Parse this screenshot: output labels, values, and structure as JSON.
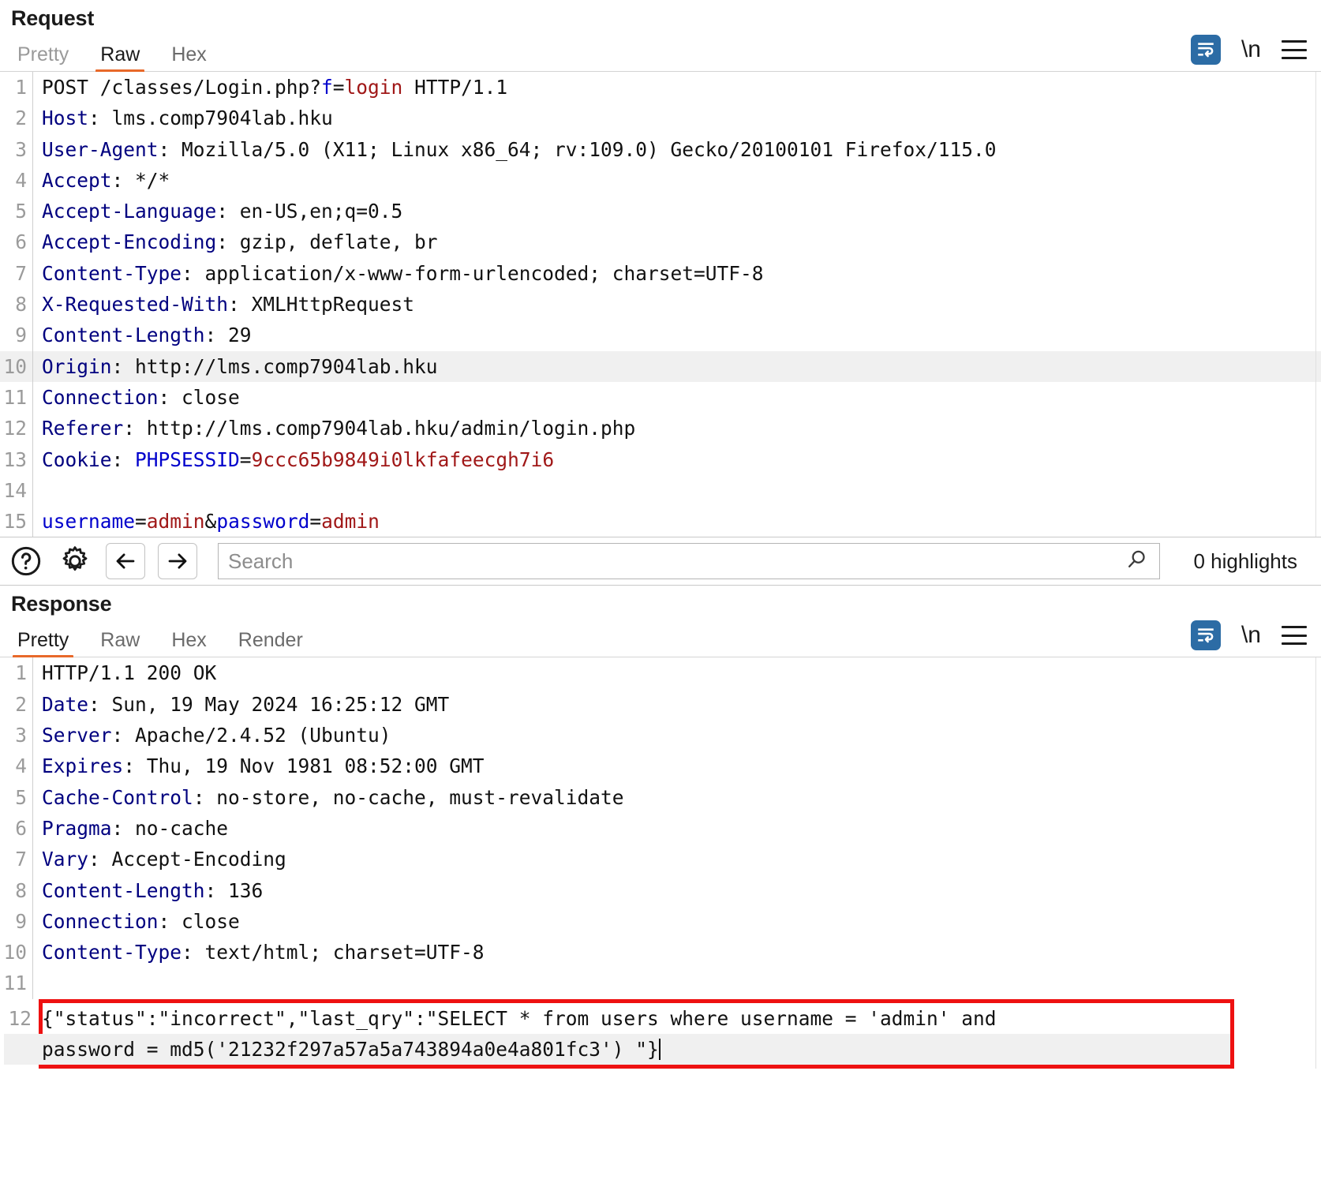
{
  "request": {
    "title": "Request",
    "tabs": [
      {
        "label": "Pretty",
        "active": false
      },
      {
        "label": "Raw",
        "active": true
      },
      {
        "label": "Hex",
        "active": false
      }
    ],
    "tools": {
      "wrap_icon": "word-wrap-icon",
      "newline_label": "\\n",
      "menu_icon": "hamburger-menu-icon"
    },
    "lines": [
      {
        "n": "1",
        "highlight": false,
        "parts": [
          {
            "t": "POST /classes/Login.php?",
            "c": "plain"
          },
          {
            "t": "f",
            "c": "blue"
          },
          {
            "t": "=",
            "c": "plain"
          },
          {
            "t": "login",
            "c": "red"
          },
          {
            "t": " HTTP/1.1",
            "c": "plain"
          }
        ]
      },
      {
        "n": "2",
        "highlight": false,
        "parts": [
          {
            "t": "Host",
            "c": "hdr"
          },
          {
            "t": ": lms.comp7904lab.hku",
            "c": "plain"
          }
        ]
      },
      {
        "n": "3",
        "highlight": false,
        "parts": [
          {
            "t": "User-Agent",
            "c": "hdr"
          },
          {
            "t": ": Mozilla/5.0 (X11; Linux x86_64; rv:109.0) Gecko/20100101 Firefox/115.0",
            "c": "plain"
          }
        ]
      },
      {
        "n": "4",
        "highlight": false,
        "parts": [
          {
            "t": "Accept",
            "c": "hdr"
          },
          {
            "t": ": */*",
            "c": "plain"
          }
        ]
      },
      {
        "n": "5",
        "highlight": false,
        "parts": [
          {
            "t": "Accept-Language",
            "c": "hdr"
          },
          {
            "t": ": en-US,en;q=0.5",
            "c": "plain"
          }
        ]
      },
      {
        "n": "6",
        "highlight": false,
        "parts": [
          {
            "t": "Accept-Encoding",
            "c": "hdr"
          },
          {
            "t": ": gzip, deflate, br",
            "c": "plain"
          }
        ]
      },
      {
        "n": "7",
        "highlight": false,
        "parts": [
          {
            "t": "Content-Type",
            "c": "hdr"
          },
          {
            "t": ": application/x-www-form-urlencoded; charset=UTF-8",
            "c": "plain"
          }
        ]
      },
      {
        "n": "8",
        "highlight": false,
        "parts": [
          {
            "t": "X-Requested-With",
            "c": "hdr"
          },
          {
            "t": ": XMLHttpRequest",
            "c": "plain"
          }
        ]
      },
      {
        "n": "9",
        "highlight": false,
        "parts": [
          {
            "t": "Content-Length",
            "c": "hdr"
          },
          {
            "t": ": 29",
            "c": "plain"
          }
        ]
      },
      {
        "n": "10",
        "highlight": true,
        "parts": [
          {
            "t": "Origin",
            "c": "hdr"
          },
          {
            "t": ": http://lms.comp7904lab.hku",
            "c": "plain"
          }
        ]
      },
      {
        "n": "11",
        "highlight": false,
        "parts": [
          {
            "t": "Connection",
            "c": "hdr"
          },
          {
            "t": ": close",
            "c": "plain"
          }
        ]
      },
      {
        "n": "12",
        "highlight": false,
        "parts": [
          {
            "t": "Referer",
            "c": "hdr"
          },
          {
            "t": ": http://lms.comp7904lab.hku/admin/login.php",
            "c": "plain"
          }
        ]
      },
      {
        "n": "13",
        "highlight": false,
        "parts": [
          {
            "t": "Cookie",
            "c": "hdr"
          },
          {
            "t": ": ",
            "c": "plain"
          },
          {
            "t": "PHPSESSID",
            "c": "blue"
          },
          {
            "t": "=",
            "c": "plain"
          },
          {
            "t": "9ccc65b9849i0lkfafeecgh7i6",
            "c": "red"
          }
        ]
      },
      {
        "n": "14",
        "highlight": false,
        "parts": [
          {
            "t": "",
            "c": "plain"
          }
        ]
      },
      {
        "n": "15",
        "highlight": false,
        "parts": [
          {
            "t": "username",
            "c": "blue"
          },
          {
            "t": "=",
            "c": "plain"
          },
          {
            "t": "admin",
            "c": "red"
          },
          {
            "t": "&",
            "c": "plain"
          },
          {
            "t": "password",
            "c": "blue"
          },
          {
            "t": "=",
            "c": "plain"
          },
          {
            "t": "admin",
            "c": "red"
          }
        ]
      }
    ]
  },
  "searchbar": {
    "help_icon": "help-circle-icon",
    "settings_icon": "gear-icon",
    "back_icon": "arrow-left-icon",
    "forward_icon": "arrow-right-icon",
    "placeholder": "Search",
    "value": "",
    "search_icon": "magnifier-icon",
    "highlights_label": "0 highlights"
  },
  "response": {
    "title": "Response",
    "tabs": [
      {
        "label": "Pretty",
        "active": true
      },
      {
        "label": "Raw",
        "active": false
      },
      {
        "label": "Hex",
        "active": false
      },
      {
        "label": "Render",
        "active": false
      }
    ],
    "tools": {
      "wrap_icon": "word-wrap-icon",
      "newline_label": "\\n",
      "menu_icon": "hamburger-menu-icon"
    },
    "lines": [
      {
        "n": "1",
        "highlight": false,
        "parts": [
          {
            "t": "HTTP/1.1 200 OK",
            "c": "plain"
          }
        ]
      },
      {
        "n": "2",
        "highlight": false,
        "parts": [
          {
            "t": "Date",
            "c": "hdr"
          },
          {
            "t": ": Sun, 19 May 2024 16:25:12 GMT",
            "c": "plain"
          }
        ]
      },
      {
        "n": "3",
        "highlight": false,
        "parts": [
          {
            "t": "Server",
            "c": "hdr"
          },
          {
            "t": ": Apache/2.4.52 (Ubuntu)",
            "c": "plain"
          }
        ]
      },
      {
        "n": "4",
        "highlight": false,
        "parts": [
          {
            "t": "Expires",
            "c": "hdr"
          },
          {
            "t": ": Thu, 19 Nov 1981 08:52:00 GMT",
            "c": "plain"
          }
        ]
      },
      {
        "n": "5",
        "highlight": false,
        "parts": [
          {
            "t": "Cache-Control",
            "c": "hdr"
          },
          {
            "t": ": no-store, no-cache, must-revalidate",
            "c": "plain"
          }
        ]
      },
      {
        "n": "6",
        "highlight": false,
        "parts": [
          {
            "t": "Pragma",
            "c": "hdr"
          },
          {
            "t": ": no-cache",
            "c": "plain"
          }
        ]
      },
      {
        "n": "7",
        "highlight": false,
        "parts": [
          {
            "t": "Vary",
            "c": "hdr"
          },
          {
            "t": ": Accept-Encoding",
            "c": "plain"
          }
        ]
      },
      {
        "n": "8",
        "highlight": false,
        "parts": [
          {
            "t": "Content-Length",
            "c": "hdr"
          },
          {
            "t": ": 136",
            "c": "plain"
          }
        ]
      },
      {
        "n": "9",
        "highlight": false,
        "parts": [
          {
            "t": "Connection",
            "c": "hdr"
          },
          {
            "t": ": close",
            "c": "plain"
          }
        ]
      },
      {
        "n": "10",
        "highlight": false,
        "parts": [
          {
            "t": "Content-Type",
            "c": "hdr"
          },
          {
            "t": ": text/html; charset=UTF-8",
            "c": "plain"
          }
        ]
      },
      {
        "n": "11",
        "highlight": false,
        "parts": [
          {
            "t": "",
            "c": "plain"
          }
        ]
      }
    ],
    "body": {
      "line_number": "12",
      "segment_1": "{\"status\":\"incorrect\",\"last_qry\":\"SELECT * from users where username = 'admin' and ",
      "segment_2": "password = md5('21232f297a57a5a743894a0e4a801fc3') \"}",
      "annotated": true,
      "annotation_color": "#ee1111"
    }
  },
  "colors": {
    "accent_tab": "#e8692a",
    "header_name": "#00007f",
    "param_name": "#0000cc",
    "param_value": "#a01818",
    "wrap_button": "#2c6ca5",
    "annotation": "#ee1111",
    "line_highlight": "#f0f0f0"
  }
}
